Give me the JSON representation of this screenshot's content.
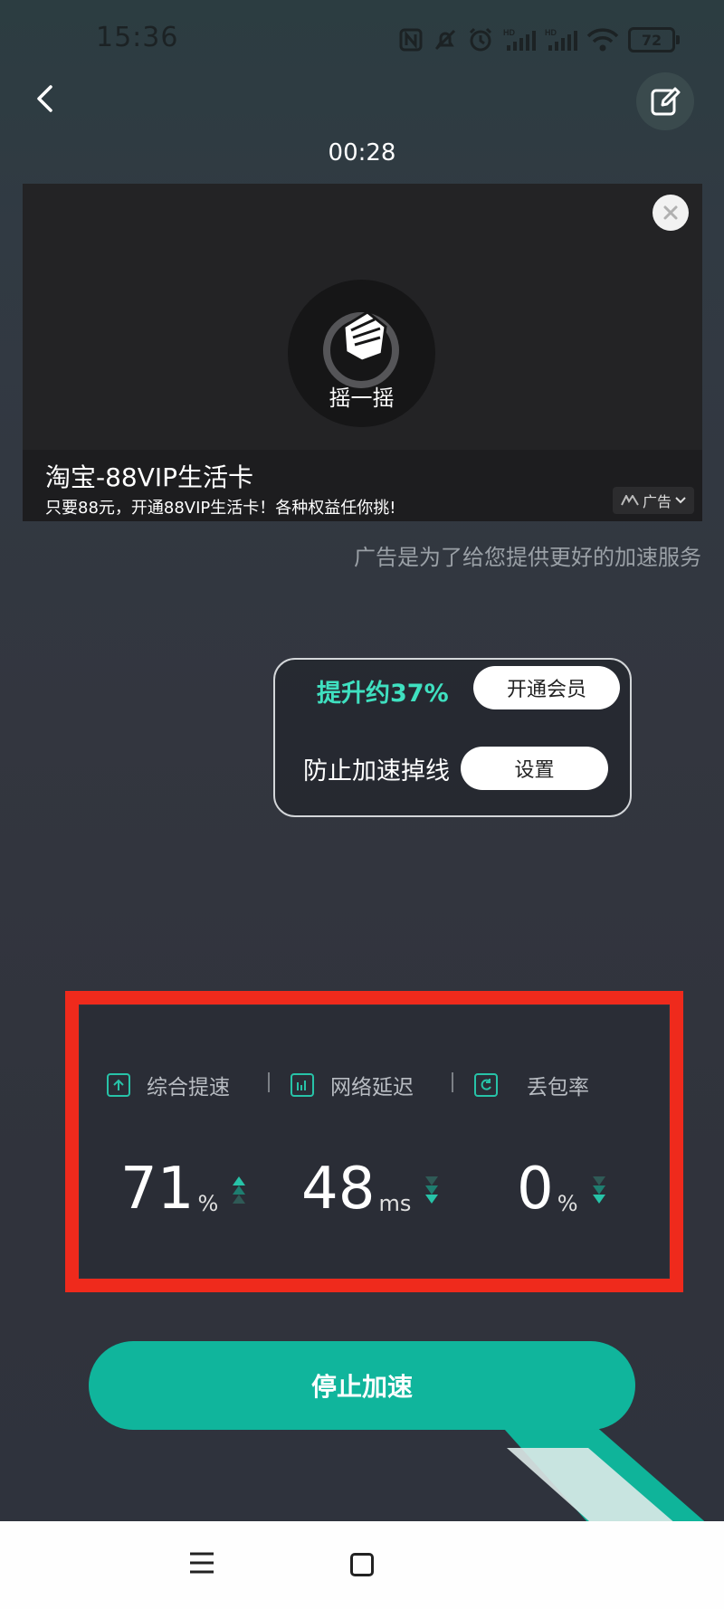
{
  "status_bar": {
    "time": "15:36",
    "battery": "72",
    "icons": [
      "nfc-icon",
      "bell-muted-icon",
      "alarm-icon",
      "signal-hd-icon",
      "signal-hd-icon",
      "wifi-icon",
      "battery-icon"
    ]
  },
  "header": {
    "timer": "00:28",
    "back_icon": "chevron-left-icon",
    "edit_icon": "edit-icon"
  },
  "ad": {
    "shake_label": "摇一摇",
    "title": "淘宝-88VIP生活卡",
    "description": "只要88元，开通88VIP生活卡！各种权益任你挑!",
    "tag": "广告",
    "note": "广告是为了给您提供更好的加速服务"
  },
  "member": {
    "boost_text": "提升约37%",
    "open_vip_label": "开通会员",
    "prevent_text": "防止加速掉线",
    "settings_label": "设置"
  },
  "stats": {
    "items": [
      {
        "label": "综合提速",
        "value": "71",
        "unit": "%",
        "trend": "up",
        "icon": "arrow-up-box-icon"
      },
      {
        "label": "网络延迟",
        "value": "48",
        "unit": "ms",
        "trend": "down",
        "icon": "bar-chart-icon"
      },
      {
        "label": "丢包率",
        "value": "0",
        "unit": "%",
        "trend": "down",
        "icon": "refresh-icon"
      }
    ]
  },
  "stop_button_label": "停止加速",
  "colors": {
    "accent": "#10b59c",
    "boost_text": "#3fe0c0",
    "highlight_frame": "#ef2a1c"
  }
}
